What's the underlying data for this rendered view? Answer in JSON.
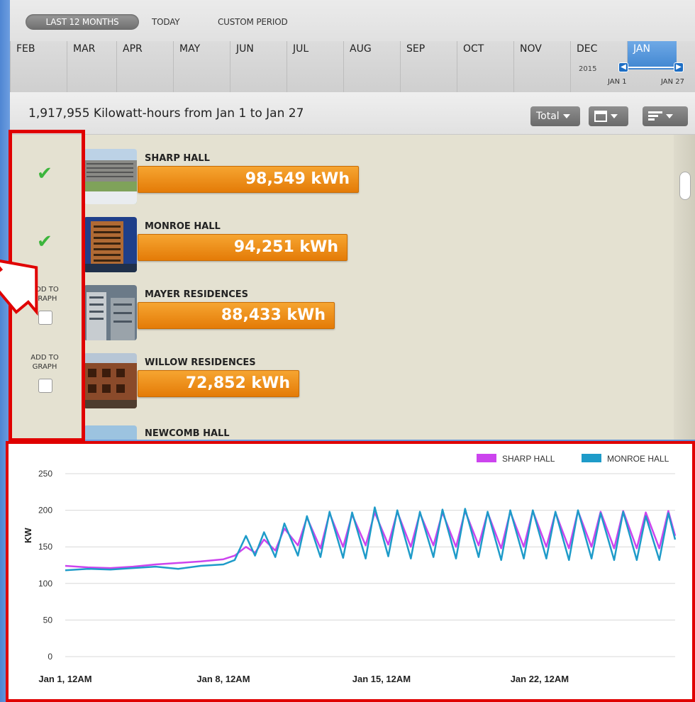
{
  "period": {
    "modes": [
      "LAST 12 MONTHS",
      "TODAY",
      "CUSTOM PERIOD"
    ],
    "months": [
      "FEB",
      "MAR",
      "APR",
      "MAY",
      "JUN",
      "JUL",
      "AUG",
      "SEP",
      "OCT",
      "NOV",
      "DEC",
      "JAN"
    ],
    "selected_month": "JAN",
    "year_label": "2015",
    "range_start": "JAN 1",
    "range_end": "JAN 27"
  },
  "summary": {
    "text": "1,917,955 Kilowatt-hours from Jan 1 to Jan 27",
    "total_label": "Total"
  },
  "buildings": [
    {
      "name": "SHARP HALL",
      "kwh": "98,549 kWh",
      "value": 98549,
      "checked": true,
      "add_label": ""
    },
    {
      "name": "MONROE HALL",
      "kwh": "94,251 kWh",
      "value": 94251,
      "checked": true,
      "add_label": ""
    },
    {
      "name": "MAYER RESIDENCES",
      "kwh": "88,433 kWh",
      "value": 88433,
      "checked": false,
      "add_label": "ADD TO\nGRAPH"
    },
    {
      "name": "WILLOW RESIDENCES",
      "kwh": "72,852 kWh",
      "value": 72852,
      "checked": false,
      "add_label": "ADD TO\nGRAPH"
    },
    {
      "name": "NEWCOMB HALL",
      "kwh": "",
      "value": null,
      "checked": false,
      "add_label": ""
    }
  ],
  "colors": {
    "sharp": "#cc44ee",
    "monroe": "#1e9bc9",
    "kwh_bar": "#ef9018",
    "highlight": "#e00000"
  },
  "chart_data": {
    "type": "line",
    "ylabel": "KW",
    "xlabel": "",
    "title": "",
    "ylim": [
      0,
      250
    ],
    "yticks": [
      0,
      50,
      100,
      150,
      200,
      250
    ],
    "xlim": [
      0,
      27
    ],
    "xticks": [
      {
        "day": 0,
        "label": "Jan 1, 12AM"
      },
      {
        "day": 7,
        "label": "Jan 8, 12AM"
      },
      {
        "day": 14,
        "label": "Jan 15, 12AM"
      },
      {
        "day": 21,
        "label": "Jan 22, 12AM"
      }
    ],
    "legend": "top-right",
    "series": [
      {
        "name": "SHARP HALL",
        "color": "#cc44ee",
        "x": [
          0,
          1,
          2,
          3,
          4,
          5,
          6,
          7,
          7.5,
          8,
          8.4,
          8.8,
          9.3,
          9.7,
          10.3,
          10.7,
          11.3,
          11.7,
          12.3,
          12.7,
          13.3,
          13.7,
          14.3,
          14.7,
          15.3,
          15.7,
          16.3,
          16.7,
          17.3,
          17.7,
          18.3,
          18.7,
          19.3,
          19.7,
          20.3,
          20.7,
          21.3,
          21.7,
          22.3,
          22.7,
          23.3,
          23.7,
          24.3,
          24.7,
          25.3,
          25.7,
          26.3,
          26.7,
          27
        ],
        "y": [
          124,
          122,
          121,
          123,
          126,
          128,
          130,
          133,
          138,
          150,
          142,
          160,
          145,
          175,
          152,
          190,
          148,
          196,
          150,
          194,
          152,
          197,
          153,
          198,
          150,
          196,
          152,
          197,
          150,
          199,
          152,
          197,
          148,
          198,
          150,
          199,
          150,
          197,
          148,
          199,
          150,
          198,
          148,
          199,
          148,
          197,
          148,
          199,
          165
        ]
      },
      {
        "name": "MONROE HALL",
        "color": "#1e9bc9",
        "x": [
          0,
          1,
          2,
          3,
          4,
          5,
          6,
          7,
          7.5,
          8,
          8.4,
          8.8,
          9.3,
          9.7,
          10.3,
          10.7,
          11.3,
          11.7,
          12.3,
          12.7,
          13.3,
          13.7,
          14.3,
          14.7,
          15.3,
          15.7,
          16.3,
          16.7,
          17.3,
          17.7,
          18.3,
          18.7,
          19.3,
          19.7,
          20.3,
          20.7,
          21.3,
          21.7,
          22.3,
          22.7,
          23.3,
          23.7,
          24.3,
          24.7,
          25.3,
          25.7,
          26.3,
          26.7,
          27
        ],
        "y": [
          118,
          120,
          119,
          121,
          123,
          120,
          124,
          126,
          132,
          165,
          138,
          170,
          136,
          182,
          138,
          192,
          136,
          198,
          135,
          197,
          134,
          204,
          137,
          200,
          134,
          198,
          136,
          201,
          134,
          202,
          136,
          198,
          132,
          200,
          134,
          200,
          134,
          198,
          132,
          200,
          134,
          196,
          132,
          198,
          132,
          192,
          132,
          196,
          160
        ]
      }
    ]
  }
}
